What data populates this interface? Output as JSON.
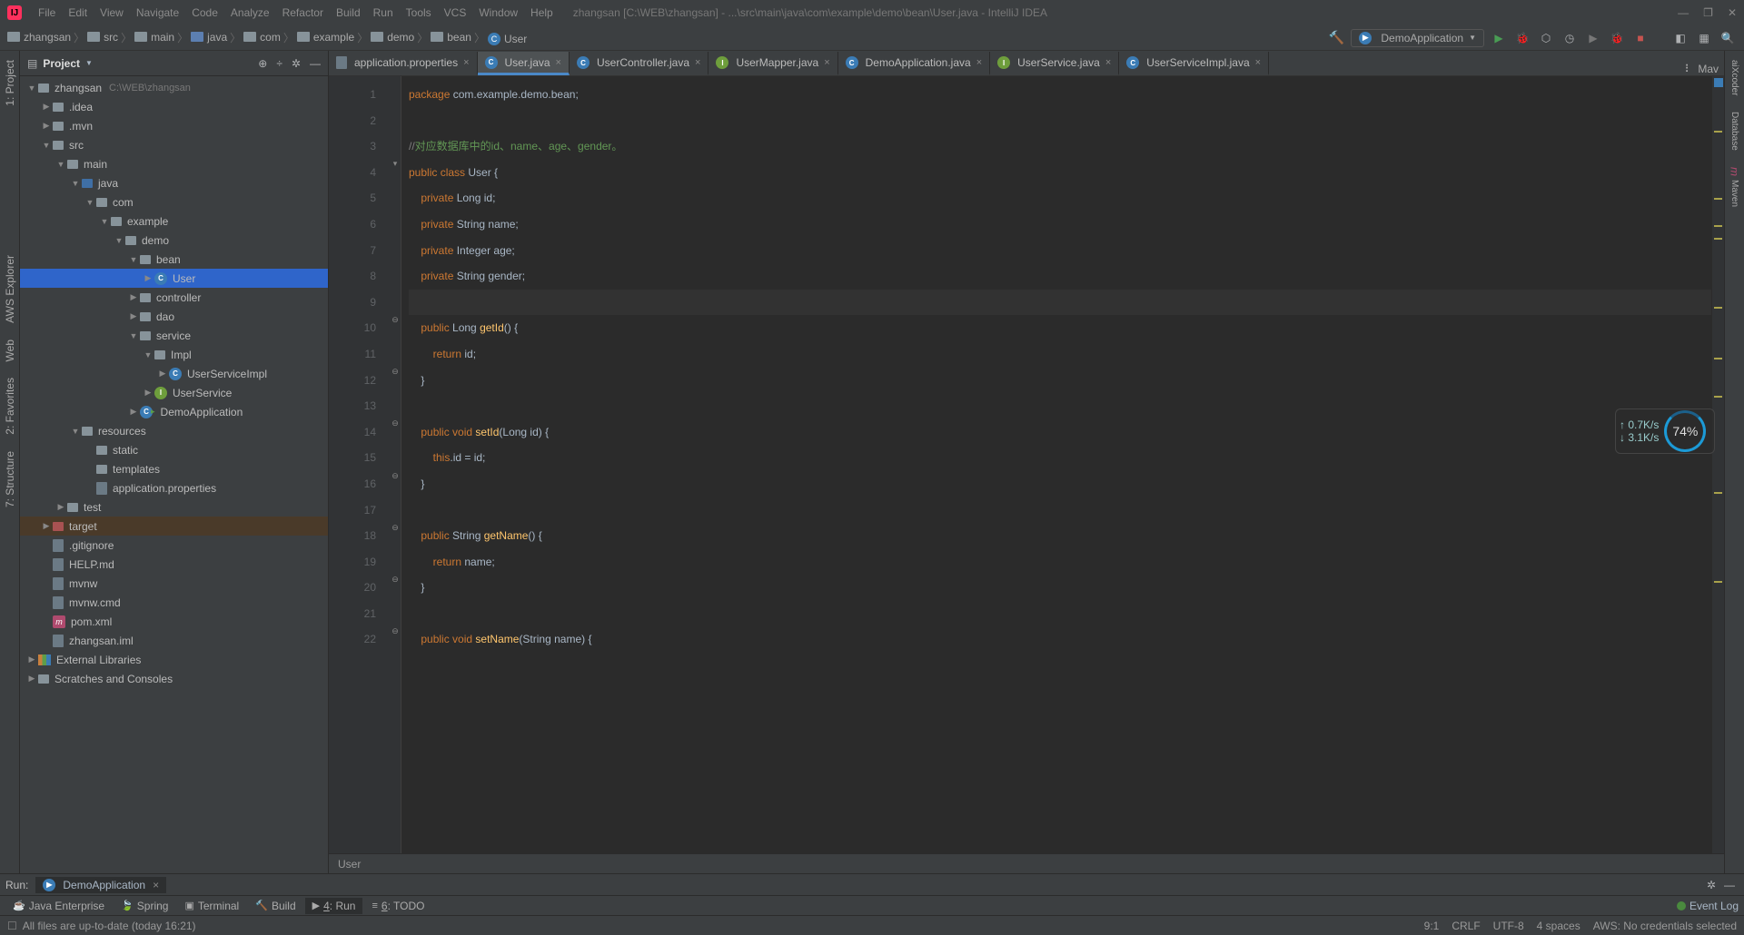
{
  "title": {
    "project": "zhangsan",
    "path": "[C:\\WEB\\zhangsan] - ...\\src\\main\\java\\com\\example\\demo\\bean\\User.java",
    "app": "IntelliJ IDEA"
  },
  "menu": {
    "file": "File",
    "edit": "Edit",
    "view": "View",
    "navigate": "Navigate",
    "code": "Code",
    "analyze": "Analyze",
    "refactor": "Refactor",
    "build": "Build",
    "run": "Run",
    "tools": "Tools",
    "vcs": "VCS",
    "window": "Window",
    "help": "Help"
  },
  "breadcrumbs": [
    "zhangsan",
    "src",
    "main",
    "java",
    "com",
    "example",
    "demo",
    "bean",
    "User"
  ],
  "run_config": "DemoApplication",
  "project_panel": {
    "title": "Project",
    "tree": [
      {
        "d": 0,
        "exp": "▼",
        "ico": "gray",
        "name": "zhangsan",
        "note": "C:\\WEB\\zhangsan"
      },
      {
        "d": 1,
        "exp": "▶",
        "ico": "gray",
        "name": ".idea"
      },
      {
        "d": 1,
        "exp": "▶",
        "ico": "gray",
        "name": ".mvn"
      },
      {
        "d": 1,
        "exp": "▼",
        "ico": "gray",
        "name": "src"
      },
      {
        "d": 2,
        "exp": "▼",
        "ico": "gray",
        "name": "main"
      },
      {
        "d": 3,
        "exp": "▼",
        "ico": "blue",
        "name": "java"
      },
      {
        "d": 4,
        "exp": "▼",
        "ico": "gray",
        "name": "com"
      },
      {
        "d": 5,
        "exp": "▼",
        "ico": "gray",
        "name": "example"
      },
      {
        "d": 6,
        "exp": "▼",
        "ico": "gray",
        "name": "demo"
      },
      {
        "d": 7,
        "exp": "▼",
        "ico": "gray",
        "name": "bean"
      },
      {
        "d": 8,
        "exp": "▶",
        "ico": "c",
        "name": "User",
        "sel": true
      },
      {
        "d": 7,
        "exp": "▶",
        "ico": "gray",
        "name": "controller"
      },
      {
        "d": 7,
        "exp": "▶",
        "ico": "gray",
        "name": "dao"
      },
      {
        "d": 7,
        "exp": "▼",
        "ico": "gray",
        "name": "service"
      },
      {
        "d": 8,
        "exp": "▼",
        "ico": "gray",
        "name": "Impl"
      },
      {
        "d": 9,
        "exp": "▶",
        "ico": "c",
        "name": "UserServiceImpl"
      },
      {
        "d": 8,
        "exp": "▶",
        "ico": "i",
        "name": "UserService"
      },
      {
        "d": 7,
        "exp": "▶",
        "ico": "c",
        "g": true,
        "name": "DemoApplication"
      },
      {
        "d": 3,
        "exp": "▼",
        "ico": "gray",
        "name": "resources"
      },
      {
        "d": 4,
        "exp": "",
        "ico": "gray",
        "name": "static"
      },
      {
        "d": 4,
        "exp": "",
        "ico": "gray",
        "name": "templates"
      },
      {
        "d": 4,
        "exp": "",
        "ico": "file",
        "name": "application.properties"
      },
      {
        "d": 2,
        "exp": "▶",
        "ico": "gray",
        "name": "test"
      },
      {
        "d": 1,
        "exp": "▶",
        "ico": "red",
        "name": "target",
        "tgt": true
      },
      {
        "d": 1,
        "exp": "",
        "ico": "file",
        "name": ".gitignore"
      },
      {
        "d": 1,
        "exp": "",
        "ico": "file",
        "name": "HELP.md"
      },
      {
        "d": 1,
        "exp": "",
        "ico": "file",
        "name": "mvnw"
      },
      {
        "d": 1,
        "exp": "",
        "ico": "file",
        "name": "mvnw.cmd"
      },
      {
        "d": 1,
        "exp": "",
        "ico": "m",
        "name": "pom.xml"
      },
      {
        "d": 1,
        "exp": "",
        "ico": "file",
        "name": "zhangsan.iml"
      },
      {
        "d": 0,
        "exp": "▶",
        "ico": "lib",
        "name": "External Libraries"
      },
      {
        "d": 0,
        "exp": "▶",
        "ico": "gray",
        "name": "Scratches and Consoles"
      }
    ]
  },
  "tabs": [
    {
      "ico": "file",
      "label": "application.properties"
    },
    {
      "ico": "c",
      "label": "User.java",
      "active": true
    },
    {
      "ico": "c",
      "label": "UserController.java"
    },
    {
      "ico": "i",
      "label": "UserMapper.java"
    },
    {
      "ico": "c",
      "g": true,
      "label": "DemoApplication.java"
    },
    {
      "ico": "i",
      "label": "UserService.java"
    },
    {
      "ico": "c",
      "label": "UserServiceImpl.java"
    }
  ],
  "tab_extra": "Mav",
  "code_lines": [
    {
      "n": 1,
      "html": "<span class='kw'>package</span> com.example.demo.bean;"
    },
    {
      "n": 2,
      "html": ""
    },
    {
      "n": 3,
      "html": "<span class='com'>//</span><span class='comg'>对应数据库中的id、name、age、gender。</span>"
    },
    {
      "n": 4,
      "html": "<span class='kw'>public class</span> User {"
    },
    {
      "n": 5,
      "html": "    <span class='kw'>private</span> Long id;"
    },
    {
      "n": 6,
      "html": "    <span class='kw'>private</span> String name;"
    },
    {
      "n": 7,
      "html": "    <span class='kw'>private</span> Integer age;"
    },
    {
      "n": 8,
      "html": "    <span class='kw'>private</span> String gender;"
    },
    {
      "n": 9,
      "html": "",
      "cur": true
    },
    {
      "n": 10,
      "html": "    <span class='kw'>public</span> Long <span class='fn'>getId</span>() {"
    },
    {
      "n": 11,
      "html": "        <span class='kw'>return</span> id;"
    },
    {
      "n": 12,
      "html": "    }"
    },
    {
      "n": 13,
      "html": ""
    },
    {
      "n": 14,
      "html": "    <span class='kw'>public void</span> <span class='fn'>setId</span>(Long id) {"
    },
    {
      "n": 15,
      "html": "        <span class='kw'>this</span>.id = id;"
    },
    {
      "n": 16,
      "html": "    }"
    },
    {
      "n": 17,
      "html": ""
    },
    {
      "n": 18,
      "html": "    <span class='kw'>public</span> String <span class='fn'>getName</span>() {"
    },
    {
      "n": 19,
      "html": "        <span class='kw'>return</span> name;"
    },
    {
      "n": 20,
      "html": "    }"
    },
    {
      "n": 21,
      "html": ""
    },
    {
      "n": 22,
      "html": "    <span class='kw'>public void</span> <span class='fn'>setName</span>(String name) {"
    }
  ],
  "crumb": "User",
  "run_tool": {
    "label": "Run:",
    "config": "DemoApplication"
  },
  "bottom_tabs": [
    {
      "ico": "☕",
      "label": "Java Enterprise"
    },
    {
      "ico": "🍃",
      "label": "Spring"
    },
    {
      "ico": "▣",
      "label": "Terminal"
    },
    {
      "ico": "🔨",
      "label": "Build"
    },
    {
      "ico": "▶",
      "label": "4: Run",
      "active": true,
      "u": true
    },
    {
      "ico": "≡",
      "label": "6: TODO",
      "u": true
    }
  ],
  "event_log": "Event Log",
  "status": {
    "msg": "All files are up-to-date (today 16:21)",
    "pos": "9:1",
    "le": "CRLF",
    "enc": "UTF-8",
    "indent": "4 spaces",
    "aws": "AWS: No credentials selected"
  },
  "left_rail": [
    "1: Project",
    "AWS Explorer",
    "Web",
    "2: Favorites",
    "7: Structure"
  ],
  "right_rail": [
    "aiXcoder",
    "Database",
    "Maven"
  ],
  "net": {
    "up": "↑ 0.7K/s",
    "down": "↓ 3.1K/s",
    "pct": "74%"
  }
}
